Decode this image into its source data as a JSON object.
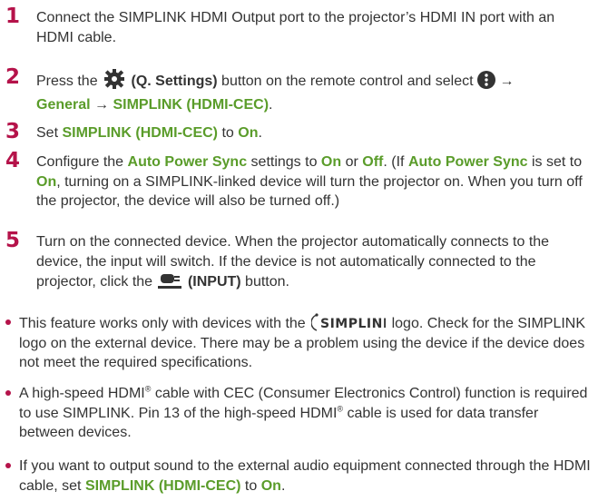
{
  "steps": [
    {
      "num": "1",
      "parts": [
        "Connect the SIMPLINK HDMI Output port to the projector’s HDMI IN port with an HDMI cable."
      ]
    },
    {
      "num": "2",
      "a": "Press the ",
      "b": "(Q. Settings)",
      "c": " button on the remote control and select ",
      "d": " → ",
      "e": "General",
      "f": " → ",
      "g": "SIMPLINK (HDMI-CEC)",
      "h": "."
    },
    {
      "num": "3",
      "a": "Set ",
      "b": "SIMPLINK (HDMI-CEC)",
      "c": " to ",
      "d": "On",
      "e": "."
    },
    {
      "num": "4",
      "a": "Configure the ",
      "b": "Auto Power Sync",
      "c": " settings to ",
      "d": "On",
      "e": " or ",
      "f": "Off",
      "g": ". (If ",
      "h": "Auto Power Sync",
      "i": " is set to ",
      "j": "On",
      "k": ", turning on a SIMPLINK-linked device will turn the projector on. When you turn off the projector, the device will also be turned off.)"
    },
    {
      "num": "5",
      "a": "Turn on the connected device. When the projector automatically connects to the device, the input will switch. If the device is not automatically connected to the projector, click the ",
      "b": "(INPUT)",
      "c": " button."
    }
  ],
  "bullets": [
    {
      "a": "This feature works only with devices with the ",
      "logo": "SIMPLINK",
      "b": " logo. Check for the SIMPLINK logo on the external device. There may be a problem using the device if the device does not meet the required specifications."
    },
    {
      "a": "A high-speed HDMI",
      "reg": "®",
      "b": " cable with CEC (Consumer Electronics Control) function is required to use SIMPLINK. Pin 13 of the high-speed HDMI",
      "reg2": "®",
      "c": " cable is used for data transfer between devices."
    },
    {
      "a": "If you want to output sound to the external audio equipment connected through the HDMI cable, set ",
      "b": "SIMPLINK (HDMI-CEC)",
      "c": " to ",
      "d": "On",
      "e": "."
    }
  ],
  "icons": {
    "settings": "gear-icon",
    "more": "more-vertical-icon",
    "input": "input-icon"
  },
  "colors": {
    "step_number": "#b5134a",
    "highlight": "#5a9c2a",
    "text": "#333333"
  }
}
